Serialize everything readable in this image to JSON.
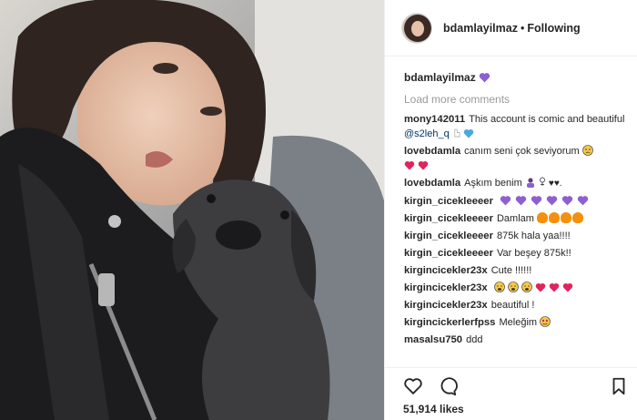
{
  "post": {
    "username": "bdamlayilmaz",
    "separator": "•",
    "follow_status": "Following",
    "caption_user": "bdamlayilmaz",
    "load_more": "Load more comments",
    "likes": "51,914 likes"
  },
  "comments": [
    {
      "user": "mony142011",
      "text": "This account is comic and beautiful",
      "mention": "@s2leh_q"
    },
    {
      "user": "lovebdamla",
      "text": "canım seni çok seviyorum"
    },
    {
      "user": "lovebdamla",
      "text": "Aşkım benim"
    },
    {
      "user": "kirgin_cicekleeeer",
      "text": ""
    },
    {
      "user": "kirgin_cicekleeeer",
      "text": "Damlam"
    },
    {
      "user": "kirgin_cicekleeeer",
      "text": "875k hala yaa!!!!"
    },
    {
      "user": "kirgin_cicekleeeer",
      "text": "Var beşey 875k!!"
    },
    {
      "user": "kirgincicekler23x",
      "text": "Cute !!!!!!"
    },
    {
      "user": "kirgincicekler23x",
      "text": ""
    },
    {
      "user": "kirgincicekler23x",
      "text": "beautiful !"
    },
    {
      "user": "kirgincickerlerfpss",
      "text": "Meleğim"
    },
    {
      "user": "masalsu750",
      "text": "ddd"
    }
  ],
  "icons": {
    "like": "heart-outline-icon",
    "comment": "speech-bubble-icon",
    "save": "bookmark-icon",
    "purple_heart": "#8f5fd2",
    "red_heart": "#e0245e",
    "fire": "#f4900c"
  }
}
